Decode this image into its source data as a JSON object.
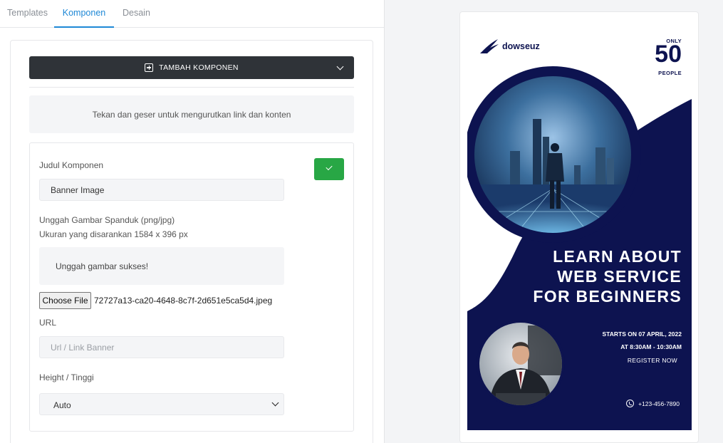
{
  "tabs": [
    {
      "label": "Templates",
      "active": false
    },
    {
      "label": "Komponen",
      "active": true
    },
    {
      "label": "Desain",
      "active": false
    }
  ],
  "toolbar": {
    "add_component_label": "TAMBAH KOMPONEN"
  },
  "hint": "Tekan dan geser untuk mengurutkan link dan konten",
  "form": {
    "title_label": "Judul Komponen",
    "title_value": "Banner Image",
    "upload_label": "Unggah Gambar Spanduk (png/jpg)",
    "upload_size": "Ukuran yang disarankan 1584 x 396 px",
    "upload_status": "Unggah gambar sukses!",
    "choose_file_label": "Choose File",
    "file_name": "72727a13-ca20-4648-8c7f-2d651e5ca5d4.jpeg",
    "url_label": "URL",
    "url_placeholder": "Url / Link Banner",
    "height_label": "Height / Tinggi",
    "height_value": "Auto"
  },
  "banner": {
    "brand": "dowseuz",
    "only": "ONLY",
    "count": "50",
    "people": "PEOPLE",
    "headline": [
      "LEARN ABOUT",
      "WEB SERVICE",
      "FOR BEGINNERS"
    ],
    "starts": "STARTS ON 07 APRIL, 2022",
    "time": "AT 8:30AM - 10:30AM",
    "register": "REGISTER NOW",
    "phone": "+123-456-7890"
  },
  "colors": {
    "accent": "#1e88d6",
    "success": "#28a745",
    "dark_button": "#2f3338",
    "banner_navy": "#0d1350"
  }
}
